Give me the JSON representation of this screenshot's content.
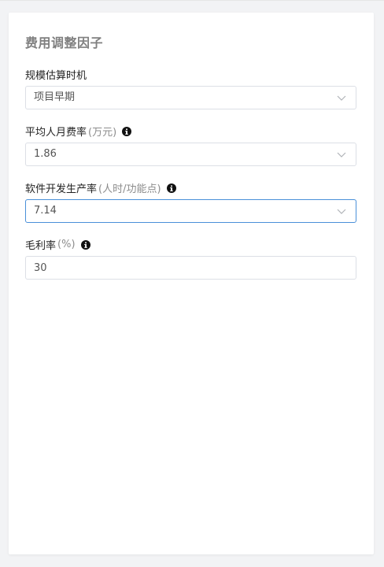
{
  "panel": {
    "title": "费用调整因子"
  },
  "fields": {
    "scale_timing": {
      "label": "规模估算时机",
      "value": "项目早期"
    },
    "avg_monthly_rate": {
      "label": "平均人月费率",
      "unit": "(万元)",
      "value": "1.86"
    },
    "productivity": {
      "label": "软件开发生产率",
      "unit": "(人时/功能点)",
      "value": "7.14"
    },
    "gross_margin": {
      "label": "毛利率",
      "unit": "(%)",
      "value": "30"
    }
  },
  "icons": {
    "info": "info-icon",
    "dropdown": "chevron-down-icon"
  },
  "colors": {
    "focus_border": "#4a90d9",
    "title": "#808080"
  }
}
